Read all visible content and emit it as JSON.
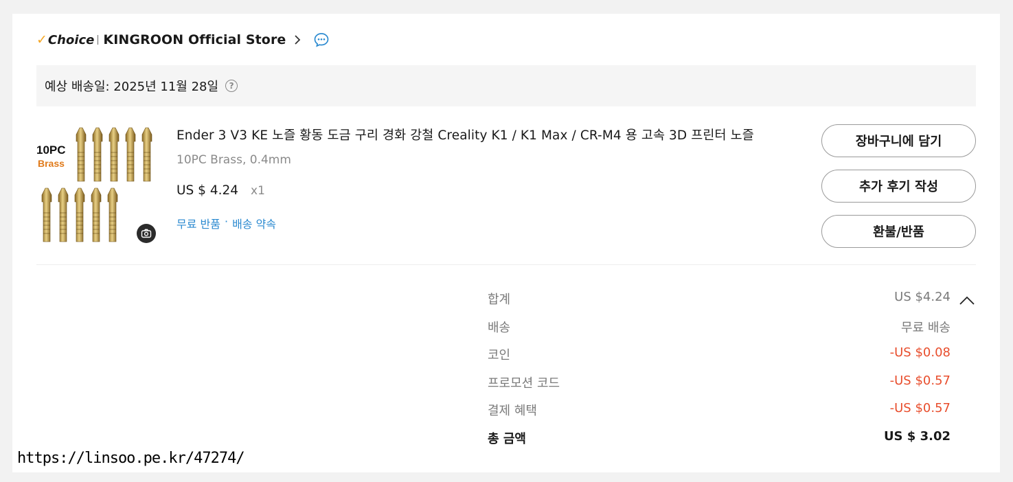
{
  "store": {
    "choice_label": "Choice",
    "name": "KINGROON Official Store"
  },
  "delivery": {
    "text": "예상 배송일: 2025년 11월 28일"
  },
  "product": {
    "image_badge": "10PC",
    "image_badge_sub": "Brass",
    "title": "Ender 3 V3 KE 노즐 황동 도금 구리 경화 강철 Creality K1 / K1 Max / CR-M4 용 고속 3D 프린터 노즐",
    "variant": "10PC Brass, 0.4mm",
    "price": "US $ 4.24",
    "quantity": "x1",
    "benefit_1": "무료 반품",
    "benefit_sep": "·",
    "benefit_2": "배송 약속"
  },
  "actions": {
    "add_to_cart": "장바구니에 담기",
    "write_review": "추가 후기 작성",
    "refund_return": "환불/반품"
  },
  "summary": {
    "rows": [
      {
        "label": "합계",
        "value": "US $4.24"
      },
      {
        "label": "배송",
        "value": "무료 배송"
      },
      {
        "label": "코인",
        "value": "-US $0.08"
      },
      {
        "label": "프로모션 코드",
        "value": "-US $0.57"
      },
      {
        "label": "결제 혜택",
        "value": "-US $0.57"
      }
    ],
    "total_label": "총 금액",
    "total_value": "US $ 3.02"
  },
  "watermark": "https://linsoo.pe.kr/47274/",
  "colors": {
    "accent_check": "#f5a623",
    "link_blue": "#2b8ad0",
    "discount_red": "#e84d2c"
  },
  "icons": [
    "chevron-right-icon",
    "chat-icon",
    "help-icon",
    "camera-icon",
    "chevron-up-icon"
  ]
}
